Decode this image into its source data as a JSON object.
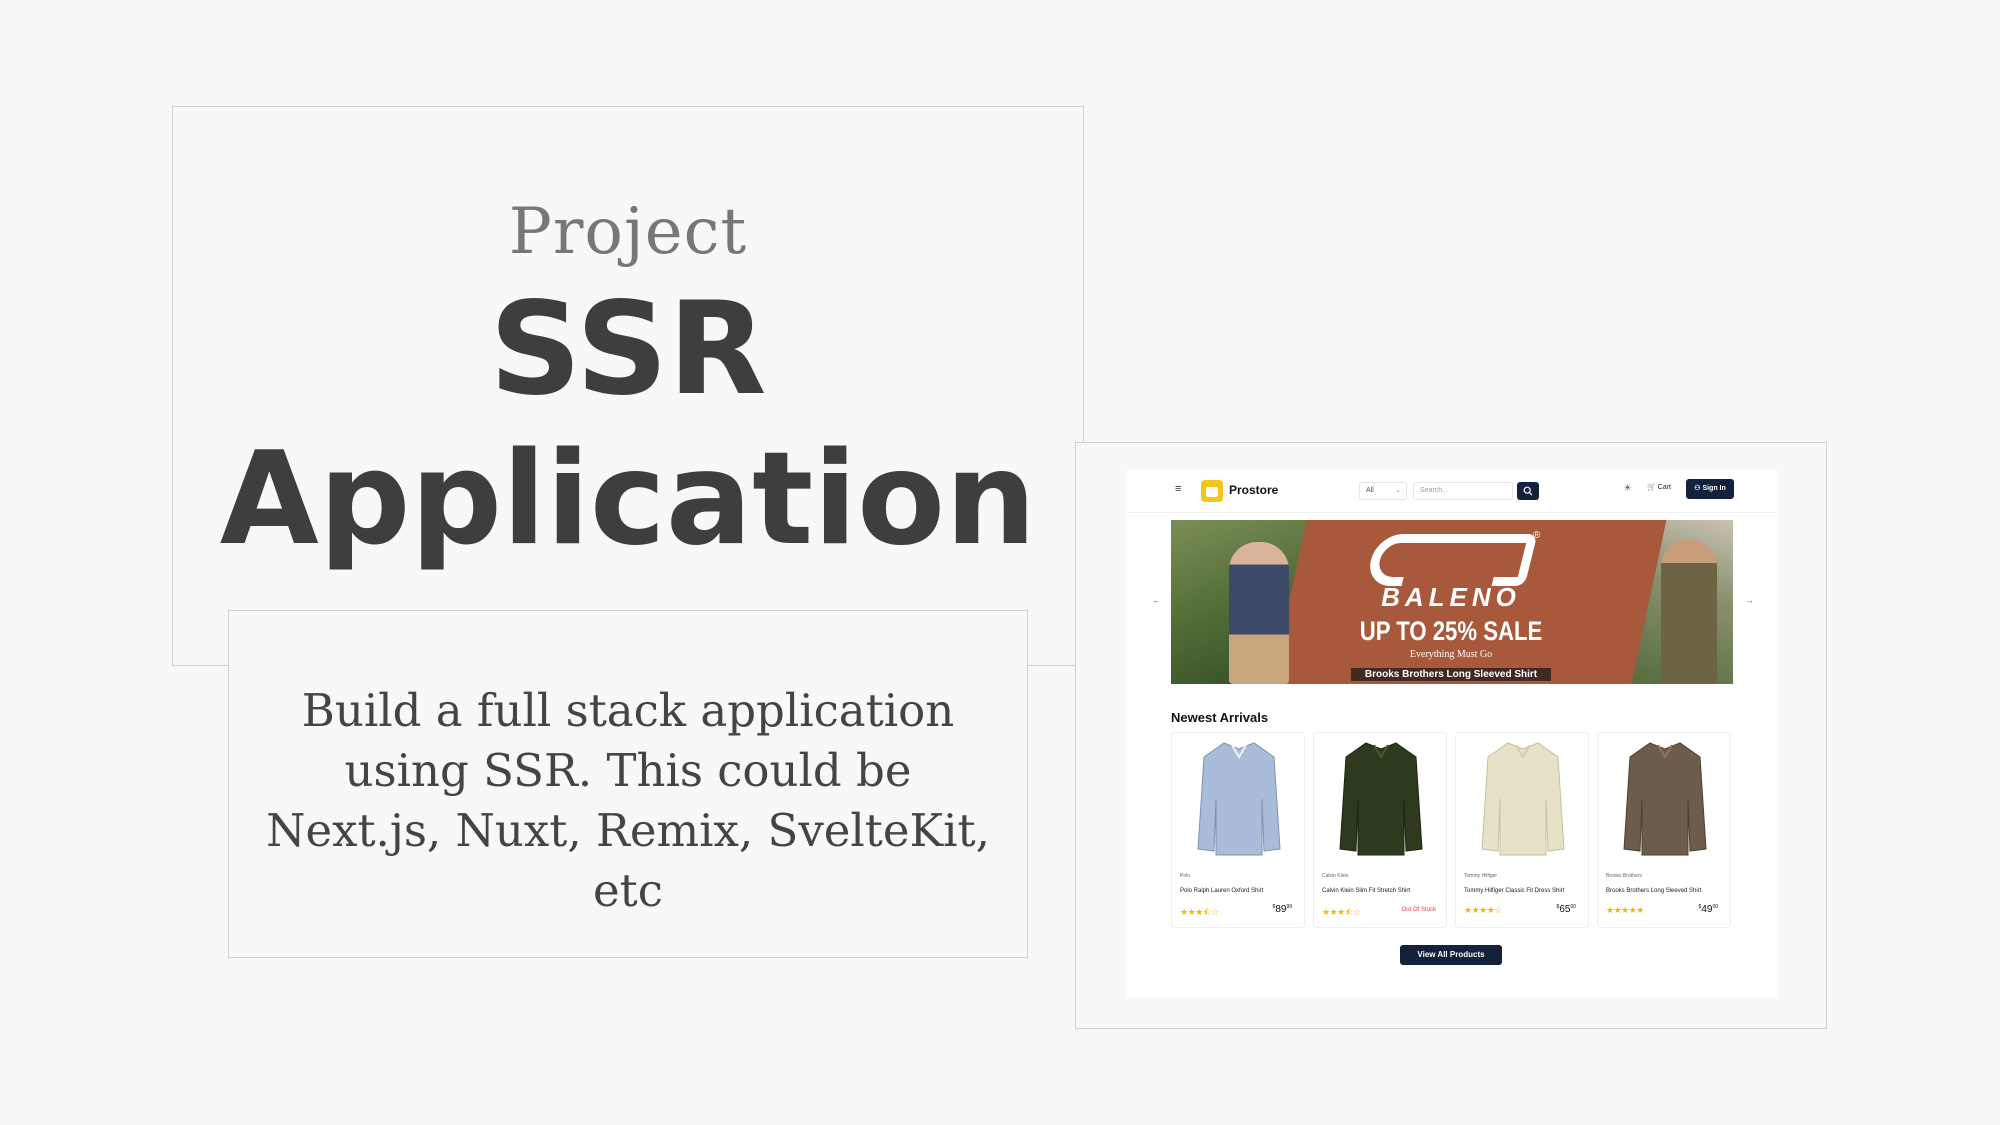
{
  "slide": {
    "kicker": "Project",
    "title_line1": "SSR",
    "title_line2": "Application",
    "description": "Build a full stack application using SSR. This could be Next.js, Nuxt, Remix, SvelteKit, etc"
  },
  "site": {
    "brand": "Prostore",
    "category_select": "All",
    "search_placeholder": "Search...",
    "cart_label": "Cart",
    "signin_label": "Sign In",
    "banner": {
      "logo_text": "BALENO",
      "registered": "®",
      "sale": "UP TO 25% SALE",
      "subline": "Everything Must Go",
      "caption": "Brooks Brothers Long Sleeved Shirt"
    },
    "section_title": "Newest Arrivals",
    "products": [
      {
        "brand": "Polo",
        "name": "Polo Ralph Lauren Oxford Shirt",
        "stars": "★★★⯪☆",
        "price_main": "89",
        "price_cents": "99",
        "price_currency": "$",
        "status": "",
        "color": "#a9bcd9"
      },
      {
        "brand": "Calvin Klein",
        "name": "Calvin Klein Slim Fit Stretch Shirt",
        "stars": "★★★⯪☆",
        "price_main": "",
        "price_cents": "",
        "price_currency": "",
        "status": "Out Of Stock",
        "color": "#2e3a1e"
      },
      {
        "brand": "Tommy Hilfiger",
        "name": "Tommy Hilfiger Classic Fit Dress Shirt",
        "stars": "★★★★☆",
        "price_main": "65",
        "price_cents": "00",
        "price_currency": "$",
        "status": "",
        "color": "#e6e2c8"
      },
      {
        "brand": "Brooks Brothers",
        "name": "Brooks Brothers Long Sleeved Shirt",
        "stars": "★★★★★",
        "price_main": "49",
        "price_cents": "00",
        "price_currency": "$",
        "status": "",
        "color": "#6d5c4a"
      }
    ],
    "view_all_label": "View All Products"
  },
  "colors": {
    "navy": "#14213d",
    "star": "#f2b705",
    "brand_yellow": "#f5c518",
    "banner_brown": "#a9593b",
    "out_of_stock": "#e0414c"
  },
  "icons": [
    "menu-icon",
    "search-icon",
    "sun-icon",
    "cart-icon",
    "user-icon",
    "chevron-left-icon",
    "chevron-right-icon",
    "chevron-down-icon"
  ]
}
